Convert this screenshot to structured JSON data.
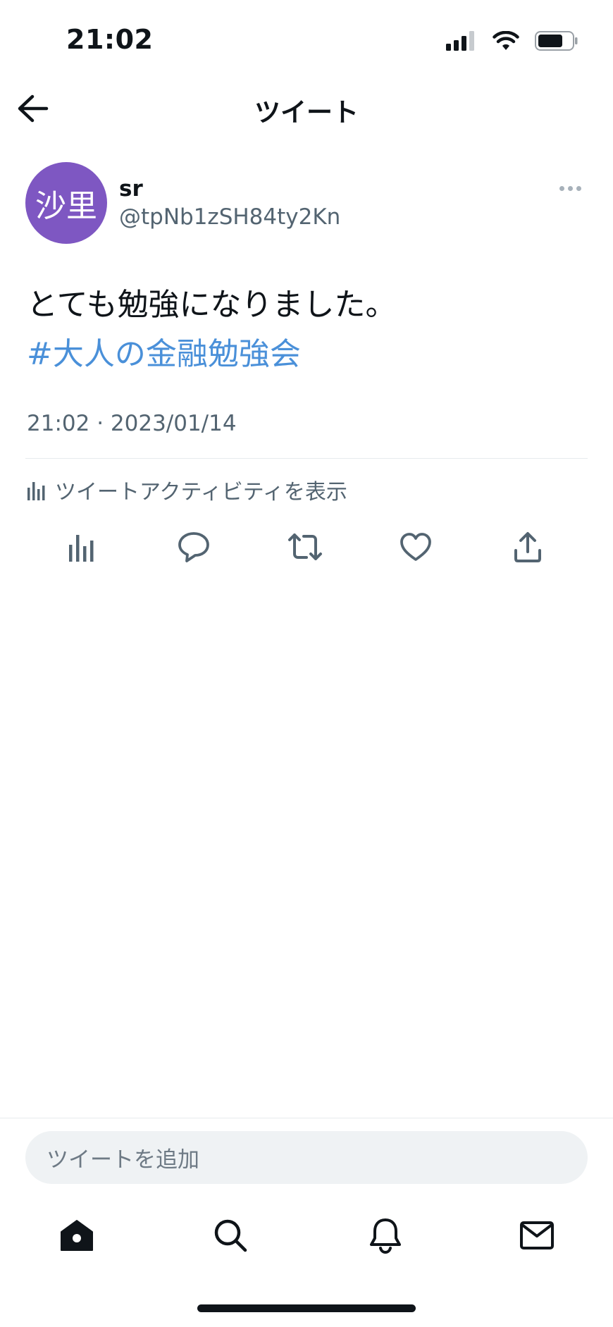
{
  "status_bar": {
    "time": "21:02"
  },
  "header": {
    "title": "ツイート"
  },
  "tweet": {
    "author": {
      "avatar_text": "沙里",
      "display_name": "sr",
      "handle": "@tpNb1zSH84ty2Kn"
    },
    "text": "とても勉強になりました。",
    "hashtag": "#大人の金融勉強会",
    "timestamp": "21:02 · 2023/01/14",
    "activity_label": "ツイートアクティビティを表示"
  },
  "actions": [
    "analytics-icon",
    "reply-icon",
    "retweet-icon",
    "like-icon",
    "share-icon"
  ],
  "compose": {
    "placeholder": "ツイートを追加"
  },
  "tab_bar": [
    "home-icon",
    "search-icon",
    "notifications-icon",
    "messages-icon"
  ],
  "colors": {
    "avatar": "#7e57c2",
    "hashtag": "#4a90d9",
    "secondary_text": "#536471"
  }
}
